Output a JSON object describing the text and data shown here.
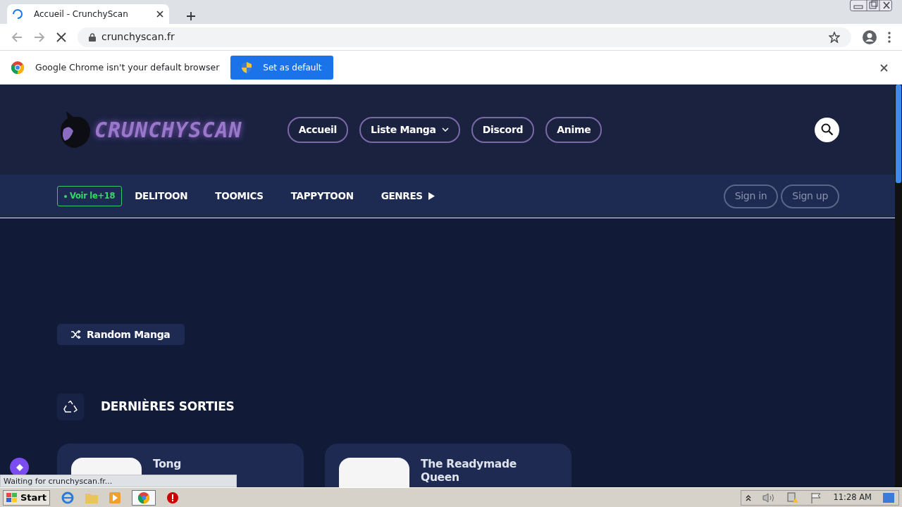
{
  "browser": {
    "tab_title": "Accueil - CrunchyScan",
    "url": "crunchyscan.fr",
    "infobar": {
      "message": "Google Chrome isn't your default browser",
      "button": "Set as default"
    }
  },
  "site": {
    "logo_text": "CRUNCHYSCAN",
    "nav_buttons": [
      {
        "label": "Accueil",
        "kind": "plain"
      },
      {
        "label": "Liste Manga",
        "kind": "dropdown"
      },
      {
        "label": "Discord",
        "kind": "plain"
      },
      {
        "label": "Anime",
        "kind": "plain"
      }
    ],
    "adult_badge": "Voir le+18",
    "sub_links": [
      {
        "label": "DELITOON",
        "kind": "plain"
      },
      {
        "label": "TOOMICS",
        "kind": "plain"
      },
      {
        "label": "TAPPYTOON",
        "kind": "plain"
      },
      {
        "label": "GENRES",
        "kind": "menu"
      }
    ],
    "auth_buttons": [
      "Sign in",
      "Sign up"
    ],
    "random_button": "Random Manga",
    "section_title": "DERNIÈRES SORTIES",
    "cards": [
      {
        "title": "Tong"
      },
      {
        "title": "The Readymade Queen"
      }
    ]
  },
  "status_text": "Waiting for crunchyscan.fr...",
  "taskbar": {
    "start": "Start",
    "clock": "11:28 AM"
  }
}
